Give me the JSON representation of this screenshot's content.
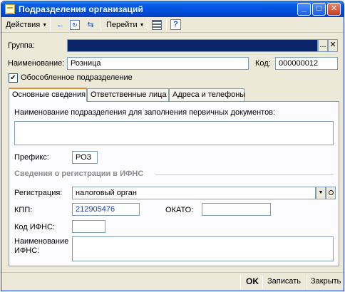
{
  "window": {
    "title": "Подразделения организаций",
    "minimize": "_",
    "maximize": "□",
    "close": "✕"
  },
  "toolbar": {
    "actions": "Действия",
    "goto": "Перейти",
    "help": "?"
  },
  "form": {
    "group_label": "Группа:",
    "group_value": "",
    "ellipsis": "...",
    "clear": "✕",
    "name_label": "Наименование:",
    "name_value": "Розница",
    "code_label": "Код:",
    "code_value": "000000012",
    "separate_checked": true,
    "separate_label": "Обособленное подразделение"
  },
  "tabs": [
    {
      "label": "Основные сведения",
      "active": true
    },
    {
      "label": "Ответственные лица",
      "active": false
    },
    {
      "label": "Адреса и телефоны",
      "active": false
    }
  ],
  "main": {
    "doc_name_label": "Наименование подразделения для заполнения первичных документов:",
    "doc_name_value": "",
    "prefix_label": "Префикс:",
    "prefix_value": "РОЗ",
    "ifns_section_title": "Сведения о регистрации в ИФНС",
    "registration_label": "Регистрация:",
    "registration_value": "налоговый орган",
    "kpp_label": "КПП:",
    "kpp_value": "212905476",
    "okato_label": "ОКАТО:",
    "okato_value": "",
    "ifns_code_label": "Код ИФНС:",
    "ifns_code_value": "",
    "ifns_name_label_1": "Наименование",
    "ifns_name_label_2": "ИФНС:",
    "ifns_name_value": ""
  },
  "footer": {
    "ok": "OK",
    "save": "Записать",
    "close": "Закрыть"
  }
}
